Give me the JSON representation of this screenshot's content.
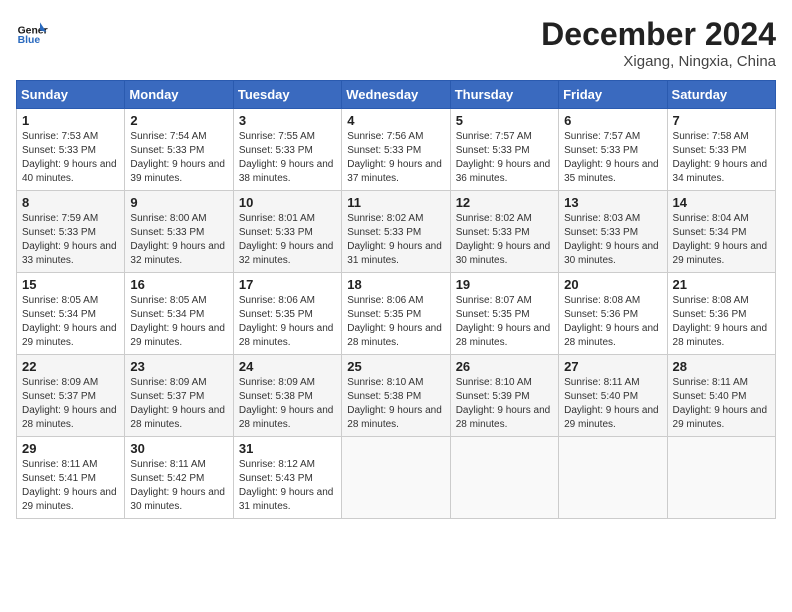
{
  "header": {
    "logo_line1": "General",
    "logo_line2": "Blue",
    "month": "December 2024",
    "location": "Xigang, Ningxia, China"
  },
  "weekdays": [
    "Sunday",
    "Monday",
    "Tuesday",
    "Wednesday",
    "Thursday",
    "Friday",
    "Saturday"
  ],
  "weeks": [
    [
      {
        "day": 1,
        "rise": "7:53 AM",
        "set": "5:33 PM",
        "daylight": "9 hours and 40 minutes."
      },
      {
        "day": 2,
        "rise": "7:54 AM",
        "set": "5:33 PM",
        "daylight": "9 hours and 39 minutes."
      },
      {
        "day": 3,
        "rise": "7:55 AM",
        "set": "5:33 PM",
        "daylight": "9 hours and 38 minutes."
      },
      {
        "day": 4,
        "rise": "7:56 AM",
        "set": "5:33 PM",
        "daylight": "9 hours and 37 minutes."
      },
      {
        "day": 5,
        "rise": "7:57 AM",
        "set": "5:33 PM",
        "daylight": "9 hours and 36 minutes."
      },
      {
        "day": 6,
        "rise": "7:57 AM",
        "set": "5:33 PM",
        "daylight": "9 hours and 35 minutes."
      },
      {
        "day": 7,
        "rise": "7:58 AM",
        "set": "5:33 PM",
        "daylight": "9 hours and 34 minutes."
      }
    ],
    [
      {
        "day": 8,
        "rise": "7:59 AM",
        "set": "5:33 PM",
        "daylight": "9 hours and 33 minutes."
      },
      {
        "day": 9,
        "rise": "8:00 AM",
        "set": "5:33 PM",
        "daylight": "9 hours and 32 minutes."
      },
      {
        "day": 10,
        "rise": "8:01 AM",
        "set": "5:33 PM",
        "daylight": "9 hours and 32 minutes."
      },
      {
        "day": 11,
        "rise": "8:02 AM",
        "set": "5:33 PM",
        "daylight": "9 hours and 31 minutes."
      },
      {
        "day": 12,
        "rise": "8:02 AM",
        "set": "5:33 PM",
        "daylight": "9 hours and 30 minutes."
      },
      {
        "day": 13,
        "rise": "8:03 AM",
        "set": "5:33 PM",
        "daylight": "9 hours and 30 minutes."
      },
      {
        "day": 14,
        "rise": "8:04 AM",
        "set": "5:34 PM",
        "daylight": "9 hours and 29 minutes."
      }
    ],
    [
      {
        "day": 15,
        "rise": "8:05 AM",
        "set": "5:34 PM",
        "daylight": "9 hours and 29 minutes."
      },
      {
        "day": 16,
        "rise": "8:05 AM",
        "set": "5:34 PM",
        "daylight": "9 hours and 29 minutes."
      },
      {
        "day": 17,
        "rise": "8:06 AM",
        "set": "5:35 PM",
        "daylight": "9 hours and 28 minutes."
      },
      {
        "day": 18,
        "rise": "8:06 AM",
        "set": "5:35 PM",
        "daylight": "9 hours and 28 minutes."
      },
      {
        "day": 19,
        "rise": "8:07 AM",
        "set": "5:35 PM",
        "daylight": "9 hours and 28 minutes."
      },
      {
        "day": 20,
        "rise": "8:08 AM",
        "set": "5:36 PM",
        "daylight": "9 hours and 28 minutes."
      },
      {
        "day": 21,
        "rise": "8:08 AM",
        "set": "5:36 PM",
        "daylight": "9 hours and 28 minutes."
      }
    ],
    [
      {
        "day": 22,
        "rise": "8:09 AM",
        "set": "5:37 PM",
        "daylight": "9 hours and 28 minutes."
      },
      {
        "day": 23,
        "rise": "8:09 AM",
        "set": "5:37 PM",
        "daylight": "9 hours and 28 minutes."
      },
      {
        "day": 24,
        "rise": "8:09 AM",
        "set": "5:38 PM",
        "daylight": "9 hours and 28 minutes."
      },
      {
        "day": 25,
        "rise": "8:10 AM",
        "set": "5:38 PM",
        "daylight": "9 hours and 28 minutes."
      },
      {
        "day": 26,
        "rise": "8:10 AM",
        "set": "5:39 PM",
        "daylight": "9 hours and 28 minutes."
      },
      {
        "day": 27,
        "rise": "8:11 AM",
        "set": "5:40 PM",
        "daylight": "9 hours and 29 minutes."
      },
      {
        "day": 28,
        "rise": "8:11 AM",
        "set": "5:40 PM",
        "daylight": "9 hours and 29 minutes."
      }
    ],
    [
      {
        "day": 29,
        "rise": "8:11 AM",
        "set": "5:41 PM",
        "daylight": "9 hours and 29 minutes."
      },
      {
        "day": 30,
        "rise": "8:11 AM",
        "set": "5:42 PM",
        "daylight": "9 hours and 30 minutes."
      },
      {
        "day": 31,
        "rise": "8:12 AM",
        "set": "5:43 PM",
        "daylight": "9 hours and 31 minutes."
      },
      null,
      null,
      null,
      null
    ]
  ]
}
